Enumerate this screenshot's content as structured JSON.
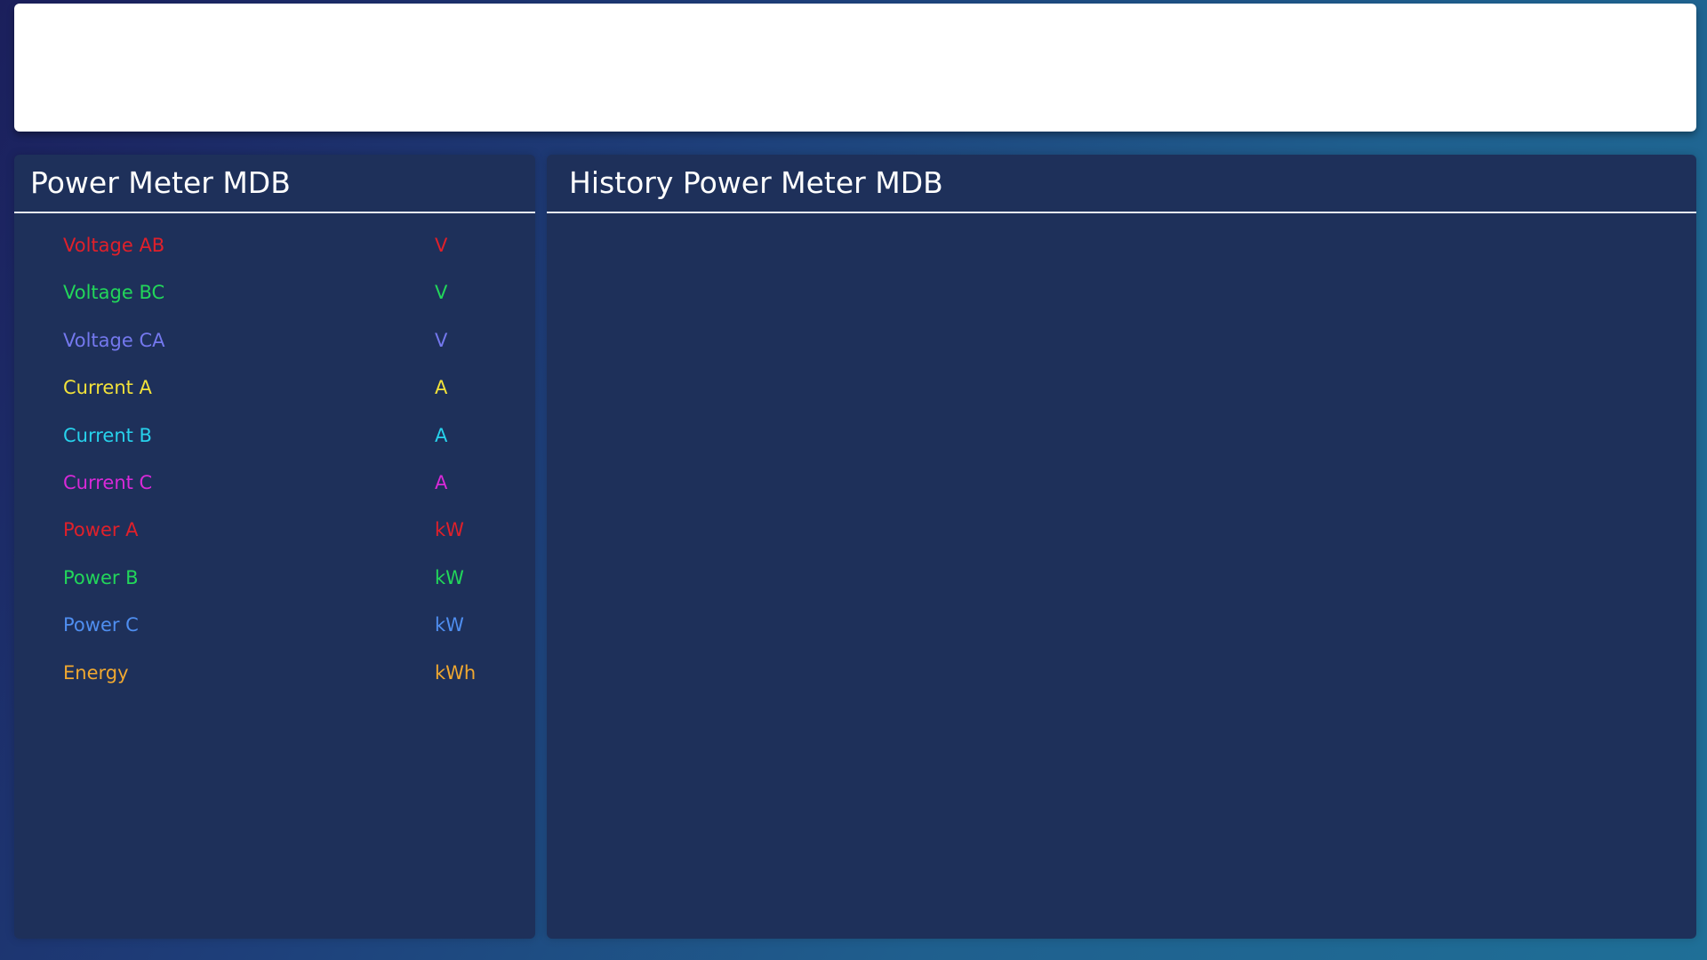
{
  "header": {
    "banner_text": ""
  },
  "meter_panel": {
    "title": "Power Meter MDB",
    "readings": [
      {
        "label": "Voltage AB",
        "value": "",
        "unit": "V",
        "color": "#e0202a"
      },
      {
        "label": "Voltage BC",
        "value": "",
        "unit": "V",
        "color": "#22d65a"
      },
      {
        "label": "Voltage CA",
        "value": "",
        "unit": "V",
        "color": "#7478ee"
      },
      {
        "label": "Current A",
        "value": "",
        "unit": "A",
        "color": "#f2e23a"
      },
      {
        "label": "Current B",
        "value": "",
        "unit": "A",
        "color": "#27d2ec"
      },
      {
        "label": "Current C",
        "value": "",
        "unit": "A",
        "color": "#d829d8"
      },
      {
        "label": "Power A",
        "value": "",
        "unit": "kW",
        "color": "#e0202a"
      },
      {
        "label": "Power B",
        "value": "",
        "unit": "kW",
        "color": "#22d65a"
      },
      {
        "label": "Power C",
        "value": "",
        "unit": "kW",
        "color": "#4f8ef0"
      },
      {
        "label": "Energy",
        "value": "",
        "unit": "kWh",
        "color": "#f0a830"
      }
    ]
  },
  "history_panel": {
    "title": "History Power Meter MDB"
  }
}
